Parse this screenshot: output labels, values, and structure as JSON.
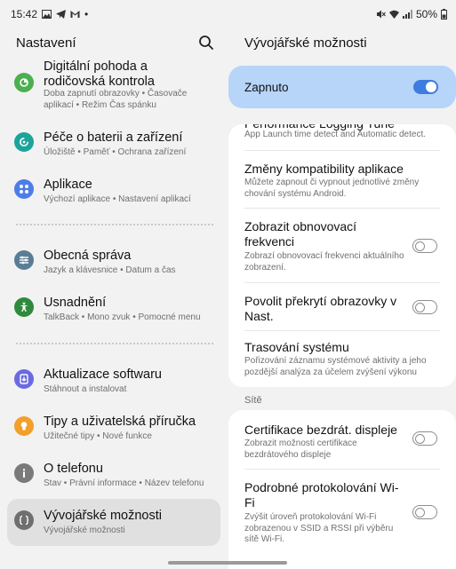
{
  "status_bar": {
    "time": "15:42",
    "battery": "50%"
  },
  "left": {
    "title": "Nastavení",
    "items": [
      {
        "title": "Digitální pohoda a rodičovská kontrola",
        "sub": "Doba zapnutí obrazovky • Časovače aplikací • Režim Čas spánku",
        "color": "#4caf50"
      },
      {
        "title": "Péče o baterii a zařízení",
        "sub": "Úložiště • Paměť • Ochrana zařízení",
        "color": "#1ba49a"
      },
      {
        "title": "Aplikace",
        "sub": "Výchozí aplikace • Nastavení aplikací",
        "color": "#4d7de8"
      },
      {
        "title": "Obecná správa",
        "sub": "Jazyk a klávesnice • Datum a čas",
        "color": "#5a7d95"
      },
      {
        "title": "Usnadnění",
        "sub": "TalkBack • Mono zvuk • Pomocné menu",
        "color": "#2f8a3e"
      },
      {
        "title": "Aktualizace softwaru",
        "sub": "Stáhnout a instalovat",
        "color": "#6a6ae0"
      },
      {
        "title": "Tipy a uživatelská příručka",
        "sub": "Užitečné tipy • Nové funkce",
        "color": "#f2a02a"
      },
      {
        "title": "O telefonu",
        "sub": "Stav • Právní informace • Název telefonu",
        "color": "#7a7a7a"
      },
      {
        "title": "Vývojářské možnosti",
        "sub": "Vývojářské možnosti",
        "color": "#6f6f6f"
      }
    ]
  },
  "right": {
    "title": "Vývojářské možnosti",
    "master": {
      "label": "Zapnuto",
      "on": true
    },
    "card1": [
      {
        "title": "Performance Logging Tune",
        "sub": "App Launch time detect and Automatic detect."
      },
      {
        "title": "Změny kompatibility aplikace",
        "sub": "Můžete zapnout či vypnout jednotlivé změny chování systému Android."
      },
      {
        "title": "Zobrazit obnovovací frekvenci",
        "sub": "Zobrazí obnovovací frekvenci aktuálního zobrazení.",
        "toggle": false
      },
      {
        "title": "Povolit překrytí obrazovky v Nast.",
        "sub": "",
        "toggle": false
      },
      {
        "title": "Trasování systému",
        "sub": "Pořizování záznamu systémové aktivity a jeho pozdější analýza za účelem zvýšení výkonu"
      }
    ],
    "section": "Sítě",
    "card2": [
      {
        "title": "Certifikace bezdrát. displeje",
        "sub": "Zobrazit možnosti certifikace bezdrátového displeje",
        "toggle": false
      },
      {
        "title": "Podrobné protokolování Wi-Fi",
        "sub": "Zvýšit úroveň protokolování Wi-Fi zobrazenou v SSID a RSSI při výběru sítě Wi-Fi.",
        "toggle": false
      }
    ]
  }
}
